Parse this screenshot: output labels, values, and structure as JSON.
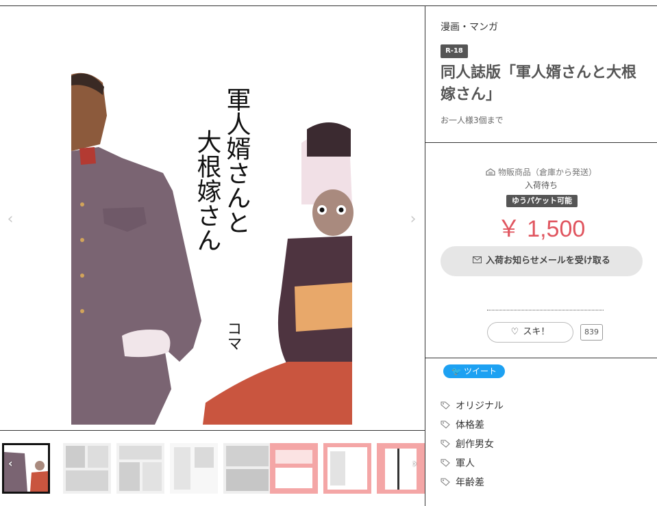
{
  "product": {
    "category": "漫画・マンガ",
    "rating_badge": "R-18",
    "title": "同人誌版「軍人婿さんと大根嫁さん」",
    "purchase_limit": "お一人様3個まで"
  },
  "cover": {
    "title_lines": [
      "軍人婿さんと",
      "大根嫁さん"
    ],
    "author": "コマ"
  },
  "purchase": {
    "shipping_type": "物販商品（倉庫から発送）",
    "stock_status": "入荷待ち",
    "shipping_badge": "ゆうパケット可能",
    "price": "￥ 1,500",
    "notify_button": "入荷お知らせメールを受け取る",
    "like_button": "スキ！",
    "like_count": "839"
  },
  "share": {
    "tweet_button": "ツイート"
  },
  "tags": [
    "オリジナル",
    "体格差",
    "創作男女",
    "軍人",
    "年齢差"
  ],
  "gallery": {
    "thumbnail_count": 8,
    "selected_index": 0,
    "thumbnail_colors": [
      "#ffffff",
      "#f2f2f2",
      "#f2f2f2",
      "#f7f7f7",
      "#efefef",
      "#f4a6a6",
      "#f4a6a6",
      "#f4a6a6"
    ]
  },
  "colors": {
    "price": "#e0555f",
    "badge": "#555555",
    "tweet": "#1da1f2"
  }
}
